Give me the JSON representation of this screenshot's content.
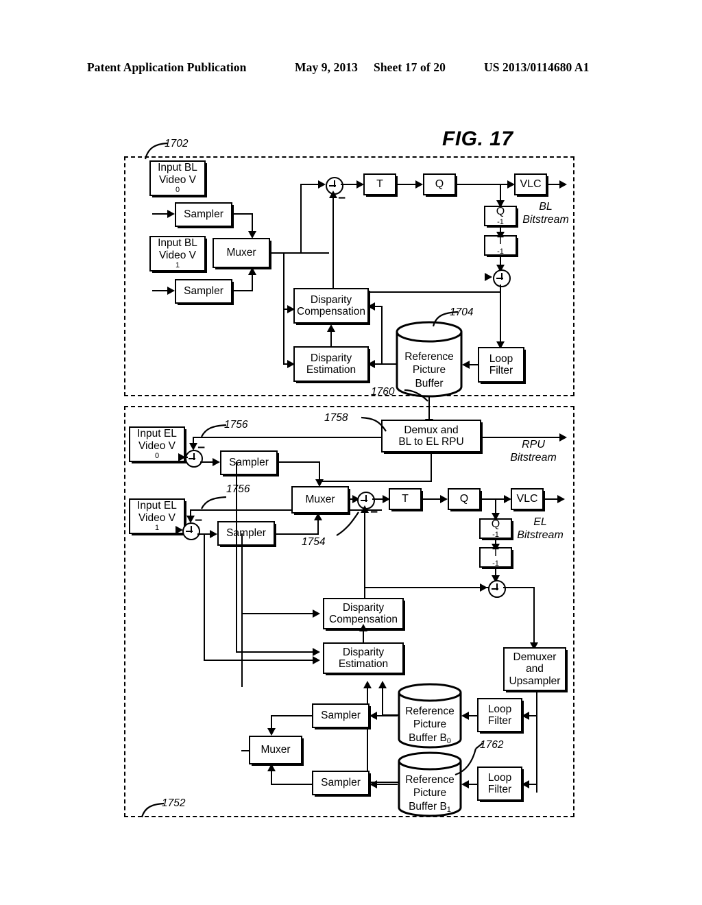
{
  "header": {
    "publication": "Patent Application Publication",
    "date": "May 9, 2013",
    "sheet": "Sheet 17 of 20",
    "patent_number": "US 2013/0114680 A1"
  },
  "figure": {
    "title": "FIG. 17",
    "type": "block-diagram",
    "sections": [
      {
        "id": "1702",
        "name": "base-layer-encoder"
      },
      {
        "id": "1752",
        "name": "enhancement-layer-encoder"
      }
    ]
  },
  "reference_numerals": {
    "bl_section": "1702",
    "bl_reference_buffer": "1704",
    "bl_to_el_link": "1760",
    "el_section": "1752",
    "el_adder_mux": "1754",
    "el_rpu_subtract_a": "1756",
    "el_rpu_subtract_b": "1756",
    "el_demux_rpu": "1758",
    "el_reference_buffers": "1762"
  },
  "base_layer": {
    "input_v0": {
      "line1": "Input BL",
      "line2": "Video V",
      "sub": "0"
    },
    "input_v1": {
      "line1": "Input BL",
      "line2": "Video V",
      "sub": "1"
    },
    "sampler_top": "Sampler",
    "sampler_bottom": "Sampler",
    "muxer": "Muxer",
    "transform": "T",
    "quantizer": "Q",
    "vlc": "VLC",
    "inverse_quantizer": {
      "base": "Q",
      "sup": "-1"
    },
    "inverse_transform": {
      "base": "T",
      "sup": "-1"
    },
    "disparity_compensation": {
      "line1": "Disparity",
      "line2": "Compensation"
    },
    "disparity_estimation": {
      "line1": "Disparity",
      "line2": "Estimation"
    },
    "reference_picture_buffer": {
      "line1": "Reference",
      "line2": "Picture",
      "line3": "Buffer"
    },
    "loop_filter": {
      "line1": "Loop",
      "line2": "Filter"
    },
    "bitstream_label": {
      "line1": "BL",
      "line2": "Bitstream"
    },
    "minus_sign": "−"
  },
  "enhancement_layer": {
    "input_v0": {
      "line1": "Input EL",
      "line2": "Video V",
      "sub": "0"
    },
    "input_v1": {
      "line1": "Input EL",
      "line2": "Video V",
      "sub": "1"
    },
    "sampler_top": "Sampler",
    "sampler_bottom": "Sampler",
    "muxer_top": "Muxer",
    "muxer_bottom": "Muxer",
    "demux_rpu": {
      "line1": "Demux and",
      "line2": "BL to EL RPU"
    },
    "transform": "T",
    "quantizer": "Q",
    "vlc": "VLC",
    "inverse_quantizer": {
      "base": "Q",
      "sup": "-1"
    },
    "inverse_transform": {
      "base": "T",
      "sup": "-1"
    },
    "disparity_compensation": {
      "line1": "Disparity",
      "line2": "Compensation"
    },
    "disparity_estimation": {
      "line1": "Disparity",
      "line2": "Estimation"
    },
    "demuxer_upsampler": {
      "line1": "Demuxer",
      "line2": "and",
      "line3": "Upsampler"
    },
    "reference_buffer_b0": {
      "line1": "Reference",
      "line2": "Picture",
      "line3": "Buffer B",
      "sub": "0"
    },
    "reference_buffer_b1": {
      "line1": "Reference",
      "line2": "Picture",
      "line3": "Buffer B",
      "sub": "1"
    },
    "loop_filter_0": {
      "line1": "Loop",
      "line2": "Filter"
    },
    "loop_filter_1": {
      "line1": "Loop",
      "line2": "Filter"
    },
    "sampler_b0": "Sampler",
    "sampler_b1": "Sampler",
    "rpu_bitstream_label": {
      "line1": "RPU",
      "line2": "Bitstream"
    },
    "el_bitstream_label": {
      "line1": "EL",
      "line2": "Bitstream"
    },
    "minus_sign": "−"
  },
  "colors": {
    "ink": "#000000",
    "paper": "#ffffff"
  }
}
